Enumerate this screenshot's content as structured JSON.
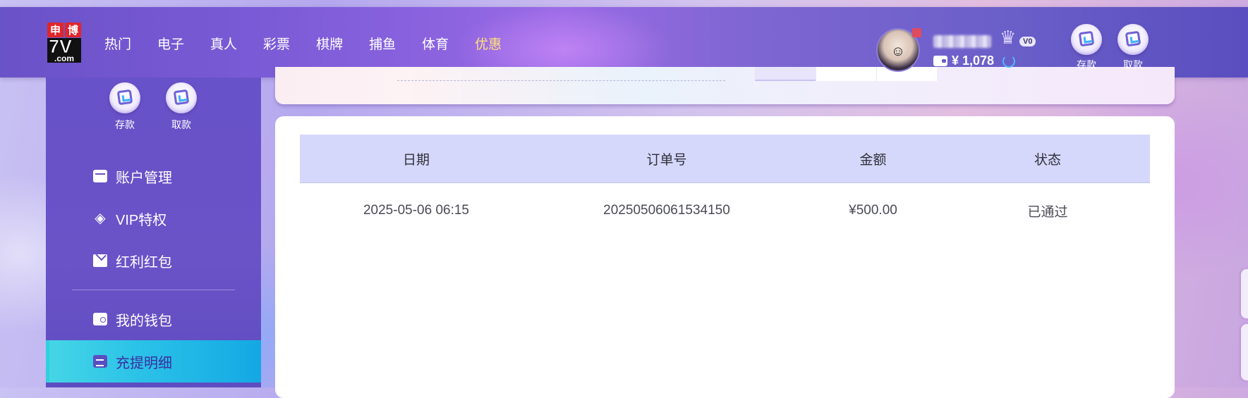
{
  "header": {
    "logo": {
      "top": [
        "申",
        "博"
      ],
      "main": "7V",
      "sub": ".com"
    },
    "nav": [
      "热门",
      "电子",
      "真人",
      "彩票",
      "棋牌",
      "捕鱼",
      "体育",
      "优惠"
    ],
    "nav_active_index": 7,
    "user": {
      "vip_level": "V0",
      "balance": "¥ 1,078"
    },
    "deposit_label": "存款",
    "withdraw_label": "取款"
  },
  "sidebar": {
    "deposit_label": "存款",
    "withdraw_label": "取款",
    "items": [
      {
        "label": "账户管理",
        "icon": "card-icon"
      },
      {
        "label": "VIP特权",
        "icon": "diamond-icon"
      },
      {
        "label": "红利红包",
        "icon": "envelope-icon"
      },
      {
        "label": "我的钱包",
        "icon": "wallet-icon"
      },
      {
        "label": "充提明细",
        "icon": "document-icon",
        "active": true
      }
    ]
  },
  "table": {
    "columns": [
      "日期",
      "订单号",
      "金额",
      "状态"
    ],
    "rows": [
      {
        "date": "2025-05-06 06:15",
        "order_no": "20250506061534150",
        "amount": "¥500.00",
        "status": "已通过"
      }
    ]
  },
  "colors": {
    "header_bg": "#7a5ad6",
    "sidebar_bg": "#6852c9",
    "active_item": "#2cc3e8",
    "nav_active": "#ffe27a",
    "table_head_bg": "#d6d8fb"
  }
}
